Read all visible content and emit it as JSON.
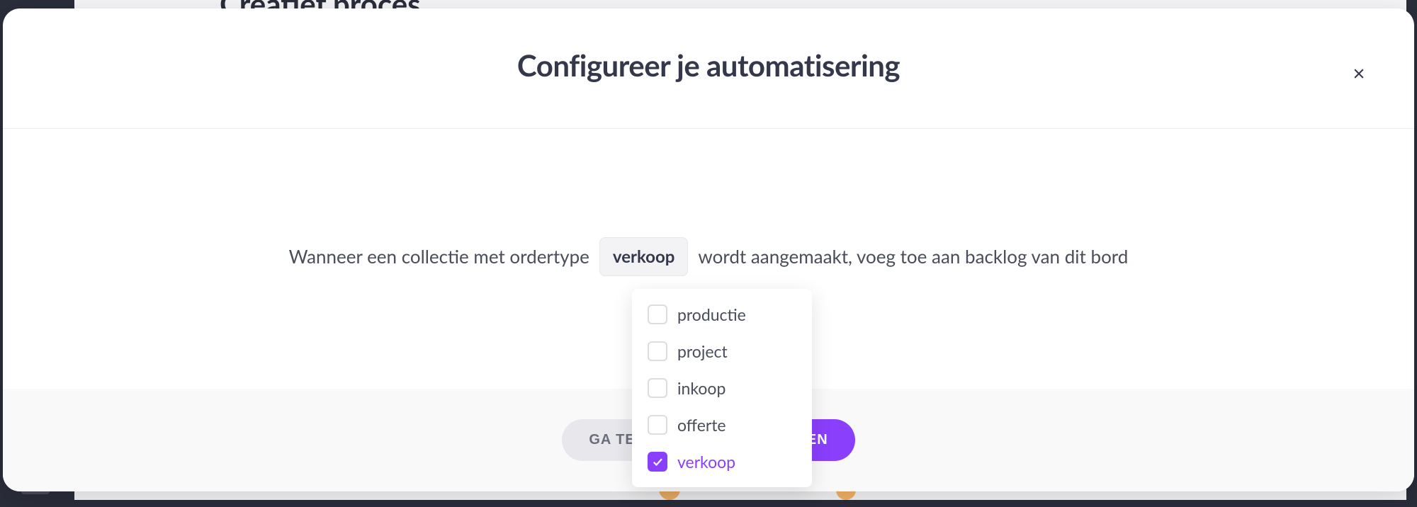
{
  "backdrop": {
    "title": "Creatief proces"
  },
  "modal": {
    "title": "Configureer je automatisering",
    "sentence": {
      "prefix": "Wanneer een collectie met ordertype",
      "selected": "verkoop",
      "suffix": "wordt aangemaakt, voeg toe aan backlog van dit bord"
    },
    "dropdown": {
      "options": [
        {
          "label": "productie",
          "checked": false
        },
        {
          "label": "project",
          "checked": false
        },
        {
          "label": "inkoop",
          "checked": false
        },
        {
          "label": "offerte",
          "checked": false
        },
        {
          "label": "verkoop",
          "checked": true
        }
      ]
    },
    "footer": {
      "back": "GA TERUG",
      "submit": "TOEPASSEN"
    }
  }
}
